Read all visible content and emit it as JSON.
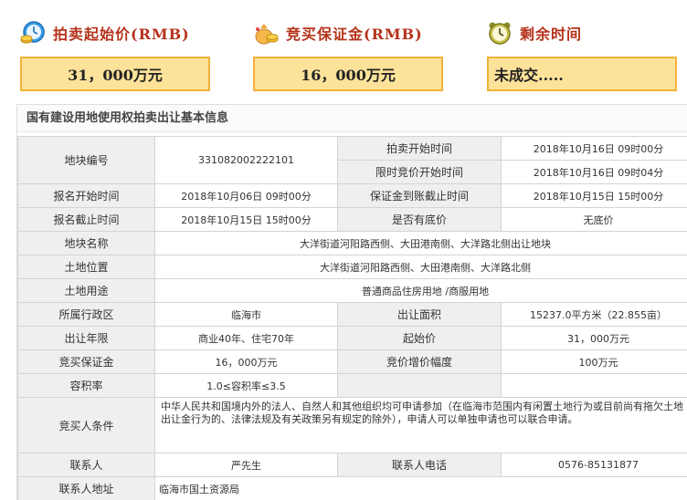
{
  "summary": {
    "start_price_label": "拍卖起始价(RMB)",
    "start_price_value": "31，000万元",
    "deposit_label": "竞买保证金(RMB)",
    "deposit_value": "16，000万元",
    "remaining_label": "剩余时间",
    "remaining_value": "未成交....."
  },
  "section": {
    "title": "国有建设用地使用权拍卖出让基本信息"
  },
  "table": {
    "parcel_no_label": "地块编号",
    "parcel_no": "331082002222101",
    "auction_start_label": "拍卖开始时间",
    "auction_start": "2018年10月16日 09时00分",
    "limited_bid_label": "限时竞价开始时间",
    "limited_bid": "2018年10月16日 09时04分",
    "signup_start_label": "报名开始时间",
    "signup_start": "2018年10月06日 09时00分",
    "deposit_deadline_label": "保证金到账截止时间",
    "deposit_deadline": "2018年10月15日 15时00分",
    "signup_end_label": "报名截止时间",
    "signup_end": "2018年10月15日 15时00分",
    "reserve_label": "是否有底价",
    "reserve": "无底价",
    "parcel_name_label": "地块名称",
    "parcel_name": "大洋街道河阳路西侧、大田港南侧、大洋路北侧出让地块",
    "location_label": "土地位置",
    "location": "大洋街道河阳路西侧、大田港南侧、大洋路北侧",
    "usage_label": "土地用途",
    "usage": "普通商品住房用地 /商服用地",
    "district_label": "所属行政区",
    "district": "临海市",
    "area_label": "出让面积",
    "area": "15237.0平方米（22.855亩）",
    "term_label": "出让年限",
    "term": "商业40年、住宅70年",
    "starting_price_label": "起始价",
    "starting_price": "31，000万元",
    "bid_deposit_label": "竞买保证金",
    "bid_deposit": "16，000万元",
    "increment_label": "竞价增价幅度",
    "increment": "100万元",
    "far_label": "容积率",
    "far": "1.0≤容积率≤3.5",
    "bidder_cond_label": "竞买人条件",
    "bidder_cond": "中华人民共和国境内外的法人、自然人和其他组织均可申请参加（在临海市范围内有闲置土地行为或目前尚有拖欠土地出让金行为的、法律法规及有关政策另有规定的除外），申请人可以单独申请也可以联合申请。",
    "contact_label": "联系人",
    "contact": "严先生",
    "phone_label": "联系人电话",
    "phone": "0576-85131877",
    "address_label": "联系人地址",
    "address": "临海市国土资源局"
  },
  "icons": {
    "start_price": "clock-coin-icon",
    "deposit": "money-bag-icon",
    "remaining": "alarm-clock-icon"
  },
  "colors": {
    "label_text": "#b5321a",
    "box_fill": "#fde29a",
    "box_border": "#f2b13a"
  }
}
